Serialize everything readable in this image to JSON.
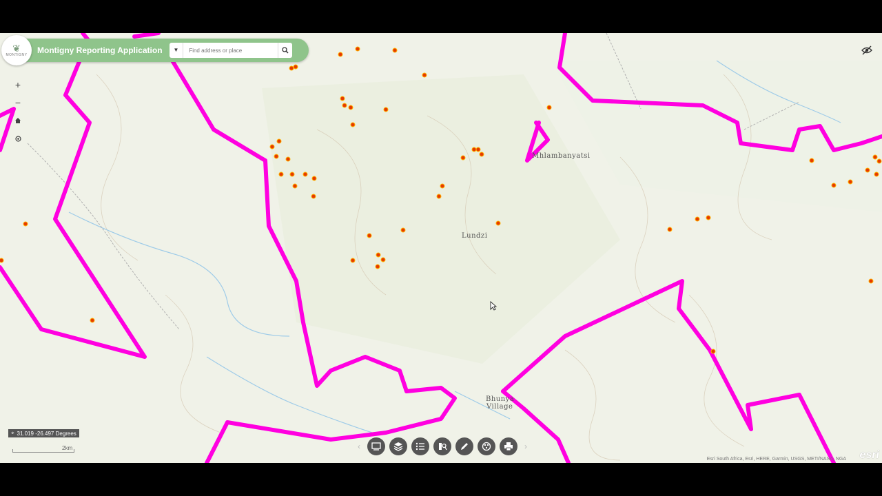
{
  "header": {
    "app_title": "Montigny Reporting Application",
    "logo_text": "MONTIGNY",
    "search_placeholder": "Find address or place"
  },
  "map": {
    "place_labels": {
      "mhlambanyatsi": "Mhlambanyatsi",
      "lundzi": "Lundzi",
      "bhunya_1": "Bhunya",
      "bhunya_2": "Village"
    },
    "coordinates_readout": "31.019 -26.497 Degrees",
    "scale_label": "2km",
    "attribution": "Esri South Africa, Esri, HERE, Garmin, USGS, METI/NASA, NGA",
    "esri_logo": "esri",
    "boundary_color": "#ff00e0",
    "point_color": "#e53a00"
  },
  "icons": {
    "zoom_in": "plus-icon",
    "zoom_out": "minus-icon",
    "home": "home-icon",
    "locate": "locate-icon",
    "search": "search-icon",
    "visibility": "eye-slash-icon"
  },
  "toolbar": {
    "tools": [
      "basemap-icon",
      "layers-icon",
      "legend-icon",
      "query-icon",
      "edit-icon",
      "analysis-icon",
      "print-icon"
    ]
  }
}
